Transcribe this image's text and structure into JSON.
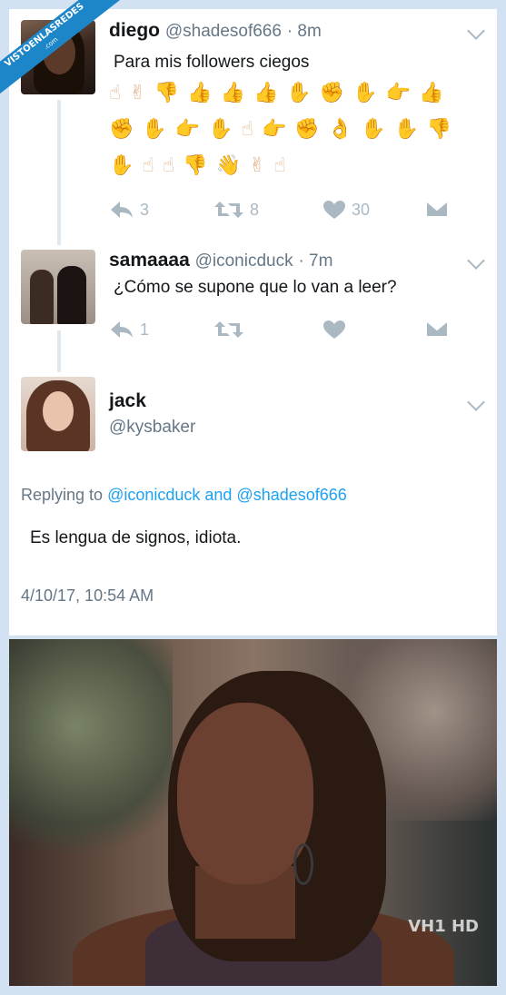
{
  "badge": {
    "text": "VISTOENLASREDES",
    "subtext": ".com"
  },
  "tweets": [
    {
      "name": "diego",
      "handle": "@shadesof666",
      "time": "· 8m",
      "text": "Para mis followers ciegos",
      "emoji_rows": [
        "☝✌👎👍👍👍✋✊✋👉👍",
        "✊✋👉✋☝👉✊👌✋✋👎",
        "✋☝☝👎👋✌☝"
      ],
      "actions": {
        "replies": "3",
        "retweets": "8",
        "likes": "30"
      }
    },
    {
      "name": "samaaaa",
      "handle": "@iconicduck",
      "time": "· 7m",
      "text": "¿Cómo se supone que lo van a leer?",
      "actions": {
        "replies": "1",
        "retweets": "",
        "likes": ""
      }
    },
    {
      "name": "jack",
      "handle": "@kysbaker"
    }
  ],
  "reply": {
    "replying_prefix": "Replying to",
    "replying_to": "@iconicduck and @shadesof666",
    "text": "Es lengua de signos, idiota.",
    "timestamp": "4/10/17, 10:54 AM"
  },
  "photo": {
    "watermark": "VH1 HD"
  },
  "colors": {
    "link": "#1da1f2",
    "muted": "#657786",
    "icon": "#aab8c2",
    "badge": "#1d86c8"
  }
}
